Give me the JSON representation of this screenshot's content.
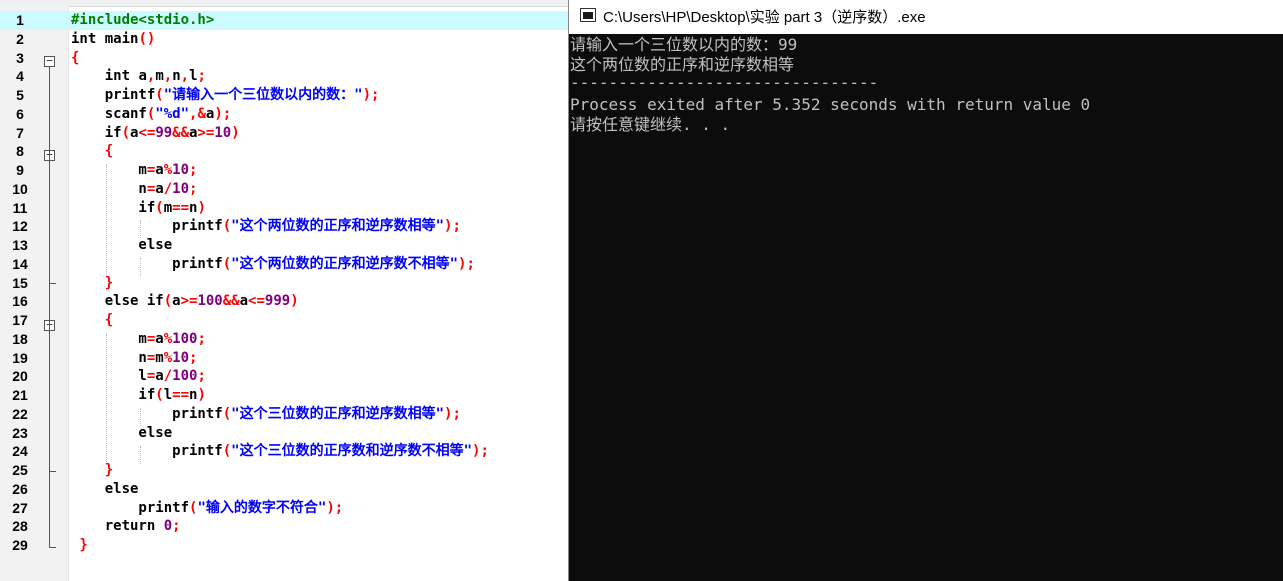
{
  "editor": {
    "lines": [
      {
        "n": "1",
        "tokens": [
          {
            "t": "#include<stdio.h>",
            "c": "pre"
          }
        ]
      },
      {
        "n": "2",
        "tokens": [
          {
            "t": "int",
            "c": "kw"
          },
          {
            "t": " main",
            "c": "id"
          },
          {
            "t": "()",
            "c": "sym"
          }
        ]
      },
      {
        "n": "3",
        "tokens": [
          {
            "t": "{",
            "c": "sym"
          }
        ]
      },
      {
        "n": "4",
        "tokens": [
          {
            "t": "    int",
            "c": "kw"
          },
          {
            "t": " a",
            "c": "id"
          },
          {
            "t": ",",
            "c": "sym"
          },
          {
            "t": "m",
            "c": "id"
          },
          {
            "t": ",",
            "c": "sym"
          },
          {
            "t": "n",
            "c": "id"
          },
          {
            "t": ",",
            "c": "sym"
          },
          {
            "t": "l",
            "c": "id"
          },
          {
            "t": ";",
            "c": "sym"
          }
        ]
      },
      {
        "n": "5",
        "tokens": [
          {
            "t": "    printf",
            "c": "id"
          },
          {
            "t": "(",
            "c": "sym"
          },
          {
            "t": "\"请输入一个三位数以内的数：\"",
            "c": "str"
          },
          {
            "t": ");",
            "c": "sym"
          }
        ]
      },
      {
        "n": "6",
        "tokens": [
          {
            "t": "    scanf",
            "c": "id"
          },
          {
            "t": "(",
            "c": "sym"
          },
          {
            "t": "\"%d\"",
            "c": "str"
          },
          {
            "t": ",&",
            "c": "sym"
          },
          {
            "t": "a",
            "c": "id"
          },
          {
            "t": ");",
            "c": "sym"
          }
        ]
      },
      {
        "n": "7",
        "tokens": [
          {
            "t": "    if",
            "c": "kw"
          },
          {
            "t": "(",
            "c": "sym"
          },
          {
            "t": "a",
            "c": "id"
          },
          {
            "t": "<=",
            "c": "sym"
          },
          {
            "t": "99",
            "c": "num"
          },
          {
            "t": "&&",
            "c": "sym"
          },
          {
            "t": "a",
            "c": "id"
          },
          {
            "t": ">=",
            "c": "sym"
          },
          {
            "t": "10",
            "c": "num"
          },
          {
            "t": ")",
            "c": "sym"
          }
        ]
      },
      {
        "n": "8",
        "tokens": [
          {
            "t": "    {",
            "c": "sym"
          }
        ]
      },
      {
        "n": "9",
        "tokens": [
          {
            "t": "        m",
            "c": "id"
          },
          {
            "t": "=",
            "c": "sym"
          },
          {
            "t": "a",
            "c": "id"
          },
          {
            "t": "%",
            "c": "sym"
          },
          {
            "t": "10",
            "c": "num"
          },
          {
            "t": ";",
            "c": "sym"
          }
        ]
      },
      {
        "n": "10",
        "tokens": [
          {
            "t": "        n",
            "c": "id"
          },
          {
            "t": "=",
            "c": "sym"
          },
          {
            "t": "a",
            "c": "id"
          },
          {
            "t": "/",
            "c": "sym"
          },
          {
            "t": "10",
            "c": "num"
          },
          {
            "t": ";",
            "c": "sym"
          }
        ]
      },
      {
        "n": "11",
        "tokens": [
          {
            "t": "        if",
            "c": "kw"
          },
          {
            "t": "(",
            "c": "sym"
          },
          {
            "t": "m",
            "c": "id"
          },
          {
            "t": "==",
            "c": "sym"
          },
          {
            "t": "n",
            "c": "id"
          },
          {
            "t": ")",
            "c": "sym"
          }
        ]
      },
      {
        "n": "12",
        "tokens": [
          {
            "t": "            printf",
            "c": "id"
          },
          {
            "t": "(",
            "c": "sym"
          },
          {
            "t": "\"这个两位数的正序和逆序数相等\"",
            "c": "str"
          },
          {
            "t": ");",
            "c": "sym"
          }
        ]
      },
      {
        "n": "13",
        "tokens": [
          {
            "t": "        else",
            "c": "kw"
          }
        ]
      },
      {
        "n": "14",
        "tokens": [
          {
            "t": "            printf",
            "c": "id"
          },
          {
            "t": "(",
            "c": "sym"
          },
          {
            "t": "\"这个两位数的正序和逆序数不相等\"",
            "c": "str"
          },
          {
            "t": ");",
            "c": "sym"
          }
        ]
      },
      {
        "n": "15",
        "tokens": [
          {
            "t": "    }",
            "c": "sym"
          }
        ]
      },
      {
        "n": "16",
        "tokens": [
          {
            "t": "    else if",
            "c": "kw"
          },
          {
            "t": "(",
            "c": "sym"
          },
          {
            "t": "a",
            "c": "id"
          },
          {
            "t": ">=",
            "c": "sym"
          },
          {
            "t": "100",
            "c": "num"
          },
          {
            "t": "&&",
            "c": "sym"
          },
          {
            "t": "a",
            "c": "id"
          },
          {
            "t": "<=",
            "c": "sym"
          },
          {
            "t": "999",
            "c": "num"
          },
          {
            "t": ")",
            "c": "sym"
          }
        ]
      },
      {
        "n": "17",
        "tokens": [
          {
            "t": "    {",
            "c": "sym"
          }
        ]
      },
      {
        "n": "18",
        "tokens": [
          {
            "t": "        m",
            "c": "id"
          },
          {
            "t": "=",
            "c": "sym"
          },
          {
            "t": "a",
            "c": "id"
          },
          {
            "t": "%",
            "c": "sym"
          },
          {
            "t": "100",
            "c": "num"
          },
          {
            "t": ";",
            "c": "sym"
          }
        ]
      },
      {
        "n": "19",
        "tokens": [
          {
            "t": "        n",
            "c": "id"
          },
          {
            "t": "=",
            "c": "sym"
          },
          {
            "t": "m",
            "c": "id"
          },
          {
            "t": "%",
            "c": "sym"
          },
          {
            "t": "10",
            "c": "num"
          },
          {
            "t": ";",
            "c": "sym"
          }
        ]
      },
      {
        "n": "20",
        "tokens": [
          {
            "t": "        l",
            "c": "id"
          },
          {
            "t": "=",
            "c": "sym"
          },
          {
            "t": "a",
            "c": "id"
          },
          {
            "t": "/",
            "c": "sym"
          },
          {
            "t": "100",
            "c": "num"
          },
          {
            "t": ";",
            "c": "sym"
          }
        ]
      },
      {
        "n": "21",
        "tokens": [
          {
            "t": "        if",
            "c": "kw"
          },
          {
            "t": "(",
            "c": "sym"
          },
          {
            "t": "l",
            "c": "id"
          },
          {
            "t": "==",
            "c": "sym"
          },
          {
            "t": "n",
            "c": "id"
          },
          {
            "t": ")",
            "c": "sym"
          }
        ]
      },
      {
        "n": "22",
        "tokens": [
          {
            "t": "            printf",
            "c": "id"
          },
          {
            "t": "(",
            "c": "sym"
          },
          {
            "t": "\"这个三位数的正序和逆序数相等\"",
            "c": "str"
          },
          {
            "t": ");",
            "c": "sym"
          }
        ]
      },
      {
        "n": "23",
        "tokens": [
          {
            "t": "        else",
            "c": "kw"
          }
        ]
      },
      {
        "n": "24",
        "tokens": [
          {
            "t": "            printf",
            "c": "id"
          },
          {
            "t": "(",
            "c": "sym"
          },
          {
            "t": "\"这个三位数的正序数和逆序数不相等\"",
            "c": "str"
          },
          {
            "t": ");",
            "c": "sym"
          }
        ]
      },
      {
        "n": "25",
        "tokens": [
          {
            "t": "    }",
            "c": "sym"
          }
        ]
      },
      {
        "n": "26",
        "tokens": [
          {
            "t": "    else",
            "c": "kw"
          }
        ]
      },
      {
        "n": "27",
        "tokens": [
          {
            "t": "        printf",
            "c": "id"
          },
          {
            "t": "(",
            "c": "sym"
          },
          {
            "t": "\"输入的数字不符合\"",
            "c": "str"
          },
          {
            "t": ");",
            "c": "sym"
          }
        ]
      },
      {
        "n": "28",
        "tokens": [
          {
            "t": "    return",
            "c": "kw"
          },
          {
            "t": " 0",
            "c": "num"
          },
          {
            "t": ";",
            "c": "sym"
          }
        ]
      },
      {
        "n": "29",
        "tokens": [
          {
            "t": " }",
            "c": "sym"
          }
        ]
      }
    ],
    "fold_markers": [
      "−",
      "−",
      "−"
    ]
  },
  "console": {
    "title": "C:\\Users\\HP\\Desktop\\实验 part 3（逆序数）.exe",
    "output_lines": [
      "请输入一个三位数以内的数：99",
      "这个两位数的正序和逆序数相等",
      "--------------------------------",
      "Process exited after 5.352 seconds with return value 0",
      "请按任意键继续. . ."
    ]
  },
  "colors": {
    "preprocessor": "#008000",
    "keyword": "#000000",
    "string": "#0000ff",
    "number": "#800080",
    "symbol": "#ff0000",
    "current_line": "#ccfbff",
    "console_bg": "#0c0c0c",
    "console_text": "#c0c0c0"
  }
}
